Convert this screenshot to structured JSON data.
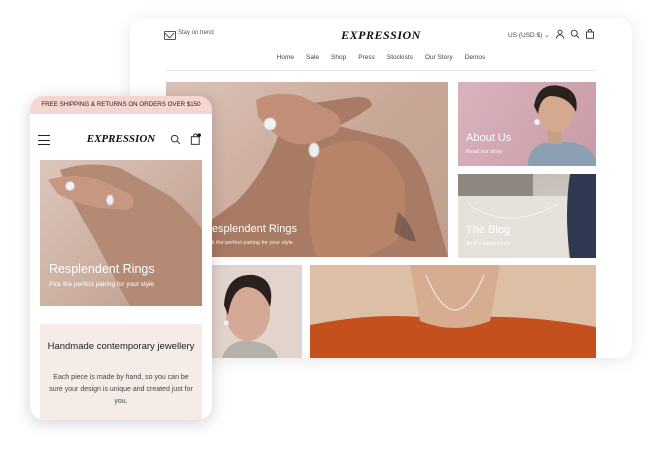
{
  "desktop": {
    "top_left_label": "Stay on trend",
    "logo": "EXPRESSION",
    "currency": "US (USD $)",
    "nav": [
      "Home",
      "Sale",
      "Shop",
      "Press",
      "Stockists",
      "Our Story",
      "Demos"
    ],
    "tiles": {
      "hero_title": "Resplendent Rings",
      "hero_subtitle": "Pick the perfect pairing for your style",
      "about_title": "About Us",
      "about_subtitle": "Read our story",
      "blog_title": "The Blog",
      "blog_subtitle": "All the latest news"
    },
    "icons": [
      "mail-icon",
      "chevron-down-icon",
      "account-icon",
      "search-icon",
      "bag-icon"
    ]
  },
  "phone": {
    "announcement": "FREE SHIPPING & RETURNS ON ORDERS OVER $150",
    "logo": "EXPRESSION",
    "hero_title": "Resplendent Rings",
    "hero_subtitle": "Pick the perfect pairing for your style",
    "card_heading": "Handmade contemporary jewellery",
    "card_body": "Each piece is made by hand, so you can be sure your design is unique and created just for you.",
    "icons": [
      "menu-icon",
      "search-icon",
      "bag-icon"
    ]
  },
  "colors": {
    "announcement_bg": "#f6d6ce",
    "card_bg": "#f5ece8",
    "hero_tone": "#c8a797"
  }
}
